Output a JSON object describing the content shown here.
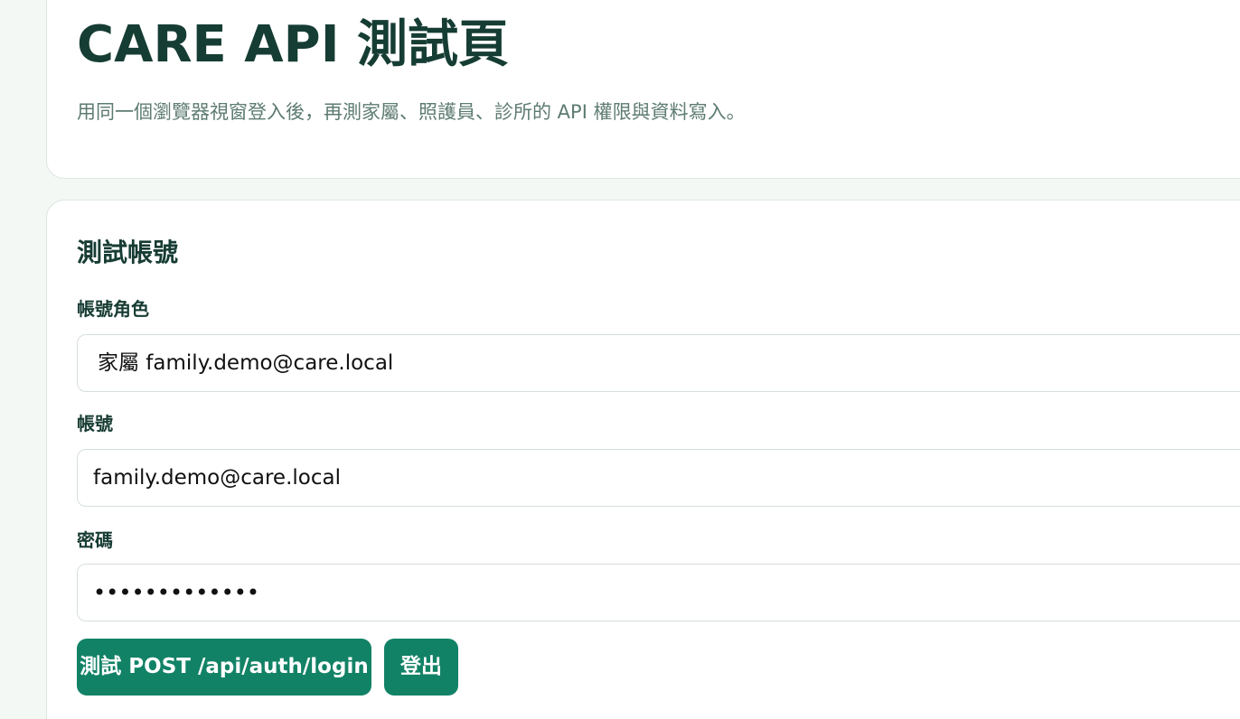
{
  "hero": {
    "title": "CARE API 測試頁",
    "subtitle": "用同一個瀏覽器視窗登入後，再測家屬、照護員、診所的 API 權限與資料寫入。"
  },
  "account_section": {
    "title": "測試帳號",
    "role_label": "帳號角色",
    "role_selected": "家屬 family.demo@care.local",
    "account_label": "帳號",
    "account_value": "family.demo@care.local",
    "password_label": "密碼",
    "password_masked": "•••••••••••••"
  },
  "actions": {
    "login_label": "測試 POST /api/auth/login",
    "logout_label": "登出"
  },
  "colors": {
    "accent": "#128266",
    "heading": "#173c33",
    "muted": "#5d7b72",
    "border": "#d6dfdb",
    "background": "#f4f8f5"
  }
}
